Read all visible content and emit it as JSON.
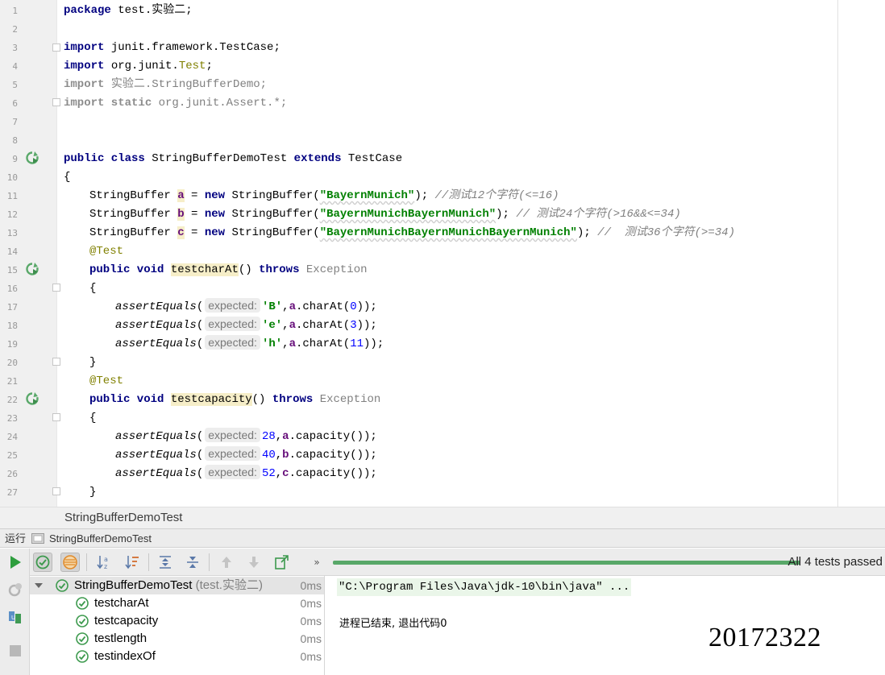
{
  "editor": {
    "line_numbers": [
      "1",
      "2",
      "3",
      "4",
      "5",
      "6",
      "7",
      "8",
      "9",
      "10",
      "11",
      "12",
      "13",
      "14",
      "15",
      "16",
      "17",
      "18",
      "19",
      "20",
      "21",
      "22",
      "23",
      "24",
      "25",
      "26",
      "27"
    ],
    "code": {
      "l1": {
        "kw": "package",
        "rest": " test.实验二;"
      },
      "l3": {
        "kw": "import",
        "rest": " junit.framework.TestCase;"
      },
      "l4": {
        "kw": "import",
        "pre": " org.junit.",
        "ann": "Test",
        "post": ";"
      },
      "l5": {
        "kw": "import",
        "rest": " 实验二.StringBufferDemo;"
      },
      "l6": {
        "kw": "import static",
        "rest": " org.junit.Assert.*;"
      },
      "l9": {
        "kw1": "public class",
        "name": " StringBufferDemoTest ",
        "kw2": "extends",
        "rest": " TestCase"
      },
      "l10": "{",
      "l11": {
        "type": "StringBuffer ",
        "var": "a",
        "eq": " = ",
        "kw": "new",
        "ctor": " StringBuffer(",
        "str": "\"BayernMunich\"",
        "end": "); ",
        "cmt": "//测试12个字符(<=16)"
      },
      "l12": {
        "type": "StringBuffer ",
        "var": "b",
        "eq": " = ",
        "kw": "new",
        "ctor": " StringBuffer(",
        "str": "\"BayernMunichBayernMunich\"",
        "end": "); ",
        "cmt": "// 测试24个字符(>16&&<=34)"
      },
      "l13": {
        "type": "StringBuffer ",
        "var": "c",
        "eq": " = ",
        "kw": "new",
        "ctor": " StringBuffer(",
        "str": "\"BayernMunichBayernMunichBayernMunich\"",
        "end": "); ",
        "cmt": "//  测试36个字符(>=34)"
      },
      "l14": "@Test",
      "l15": {
        "kw": "public void",
        "method": "testcharAt",
        "paren": "() ",
        "throws": "throws",
        "exc": " Exception"
      },
      "l16": "{",
      "l17": {
        "fn": "assertEquals",
        "open": "(",
        "hint": "expected:",
        "lit": "'B'",
        "comma": ",",
        "var": "a",
        "call": ".charAt(",
        "num": "0",
        "close": "));"
      },
      "l18": {
        "fn": "assertEquals",
        "open": "(",
        "hint": "expected:",
        "lit": "'e'",
        "comma": ",",
        "var": "a",
        "call": ".charAt(",
        "num": "3",
        "close": "));"
      },
      "l19": {
        "fn": "assertEquals",
        "open": "(",
        "hint": "expected:",
        "lit": "'h'",
        "comma": ",",
        "var": "a",
        "call": ".charAt(",
        "num": "11",
        "close": "));"
      },
      "l20": "}",
      "l21": "@Test",
      "l22": {
        "kw": "public void",
        "method": "testcapacity",
        "paren": "() ",
        "throws": "throws",
        "exc": " Exception"
      },
      "l23": "{",
      "l24": {
        "fn": "assertEquals",
        "open": "(",
        "hint": "expected:",
        "num": "28",
        "comma": ",",
        "var": "a",
        "call": ".capacity());"
      },
      "l25": {
        "fn": "assertEquals",
        "open": "(",
        "hint": "expected:",
        "num": "40",
        "comma": ",",
        "var": "b",
        "call": ".capacity());"
      },
      "l26": {
        "fn": "assertEquals",
        "open": "(",
        "hint": "expected:",
        "num": "52",
        "comma": ",",
        "var": "c",
        "call": ".capacity());"
      },
      "l27": "}"
    }
  },
  "breadcrumb": "StringBufferDemoTest",
  "run_panel": {
    "title": "运行",
    "config_name": "StringBufferDemoTest",
    "status": "All 4 tests passed",
    "progress_fraction": 1.0,
    "tree": {
      "root": {
        "label": "StringBufferDemoTest",
        "package": " (test.实验二)",
        "time": "0ms"
      },
      "tests": [
        {
          "label": "testcharAt",
          "time": "0ms"
        },
        {
          "label": "testcapacity",
          "time": "0ms"
        },
        {
          "label": "testlength",
          "time": "0ms"
        },
        {
          "label": "testindexOf",
          "time": "0ms"
        }
      ]
    },
    "console": {
      "command": "\"C:\\Program Files\\Java\\jdk-10\\bin\\java\" ...",
      "exit_message": "进程已结束, 退出代码0"
    }
  },
  "watermark": "20172322",
  "colors": {
    "pass_green": "#59a869",
    "keyword": "#000080",
    "string": "#008000"
  }
}
